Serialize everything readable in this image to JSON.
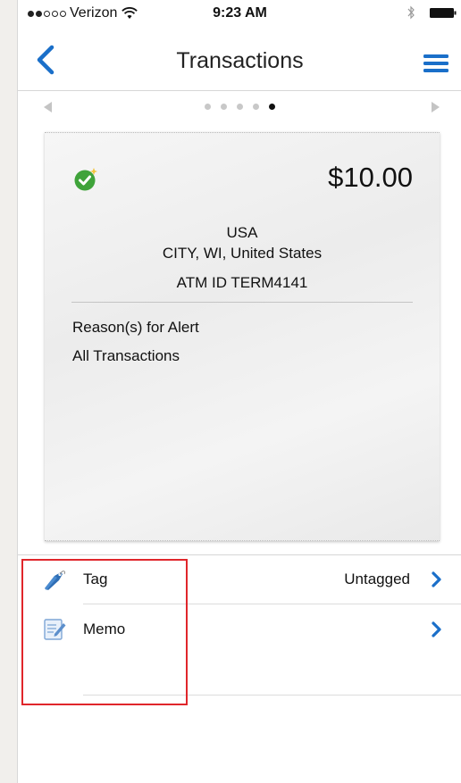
{
  "status_bar": {
    "carrier": "Verizon",
    "time": "9:23 AM",
    "signal_bars_filled": 2,
    "signal_bars_total": 5
  },
  "nav": {
    "title": "Transactions",
    "back_icon": "chevron-left-icon",
    "menu_icon": "hamburger-menu-icon",
    "accent_color": "#1a6fc9"
  },
  "pager": {
    "total_pages": 5,
    "current_page": 5
  },
  "transaction": {
    "amount": "$10.00",
    "country": "USA",
    "city_line": "CITY, WI, United States",
    "atm_id": "ATM ID TERM4141",
    "reason_title": "Reason(s) for Alert",
    "reason_value": "All Transactions",
    "status_icon": "green-check-sparkle-icon",
    "status_color": "#3fa33a"
  },
  "list": {
    "tag": {
      "label": "Tag",
      "value": "Untagged",
      "icon": "tag-icon"
    },
    "memo": {
      "label": "Memo",
      "value": "",
      "icon": "memo-pencil-icon"
    }
  },
  "annotation": {
    "highlight_color": "#e0262b"
  }
}
